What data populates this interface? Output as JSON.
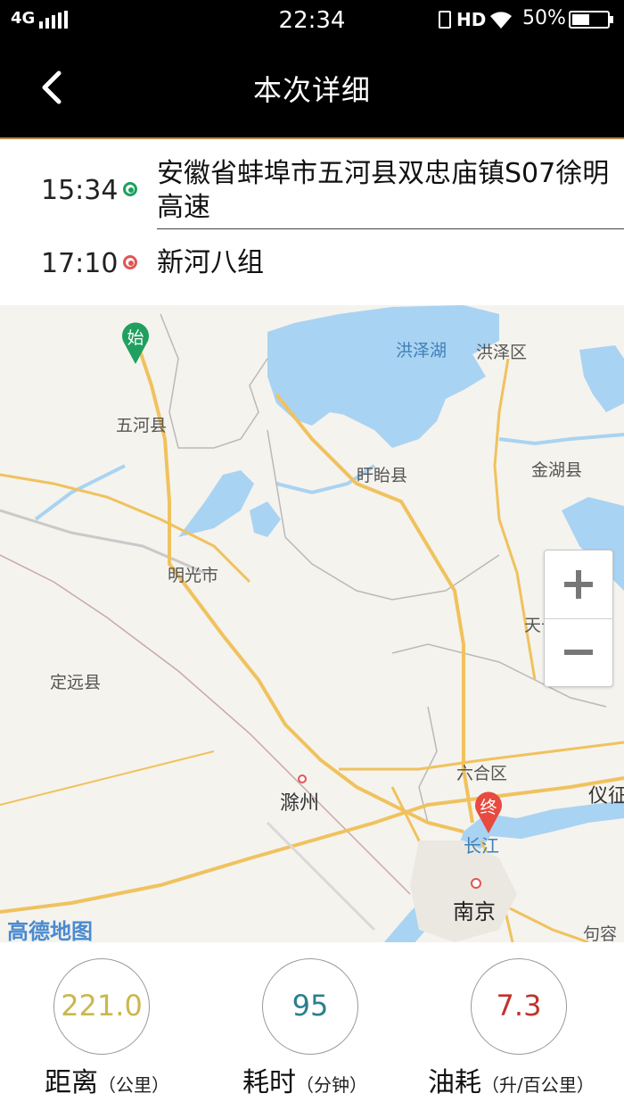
{
  "status_bar": {
    "network": "4G",
    "time": "22:34",
    "hd": "HD",
    "battery_percent": "50%"
  },
  "header": {
    "title": "本次详细"
  },
  "route": {
    "start": {
      "time": "15:34",
      "address": "安徽省蚌埠市五河县双忠庙镇S07徐明高速"
    },
    "end": {
      "time": "17:10",
      "address": "新河八组"
    }
  },
  "map": {
    "labels": {
      "hongzehu": "洪泽湖",
      "hongzequ": "洪泽区",
      "wuhe": "五河县",
      "xuyi": "盱眙县",
      "jinhu": "金湖县",
      "mingguang": "明光市",
      "tianchang": "天长市",
      "dingyuan": "定远县",
      "liuhe": "六合区",
      "chuzhou": "滁州",
      "yizheng": "仪征",
      "changjiang": "长江",
      "nanjing": "南京",
      "jurong": "句容"
    },
    "start_pin": "始",
    "end_pin": "终",
    "logo": "高德地图",
    "colors": {
      "water": "#a9d3f2",
      "road": "#f0c25e",
      "land": "#f5f3ee",
      "start_pin": "#1fa05f",
      "end_pin": "#e84a3f"
    }
  },
  "stats": [
    {
      "value": "221.0",
      "label": "距离",
      "unit": "（公里）",
      "color": "#c9b84f"
    },
    {
      "value": "95",
      "label": "耗时",
      "unit": "（分钟）",
      "color": "#2a7f8c"
    },
    {
      "value": "7.3",
      "label": "油耗",
      "unit": "（升/百公里）",
      "color": "#c0332b"
    }
  ]
}
